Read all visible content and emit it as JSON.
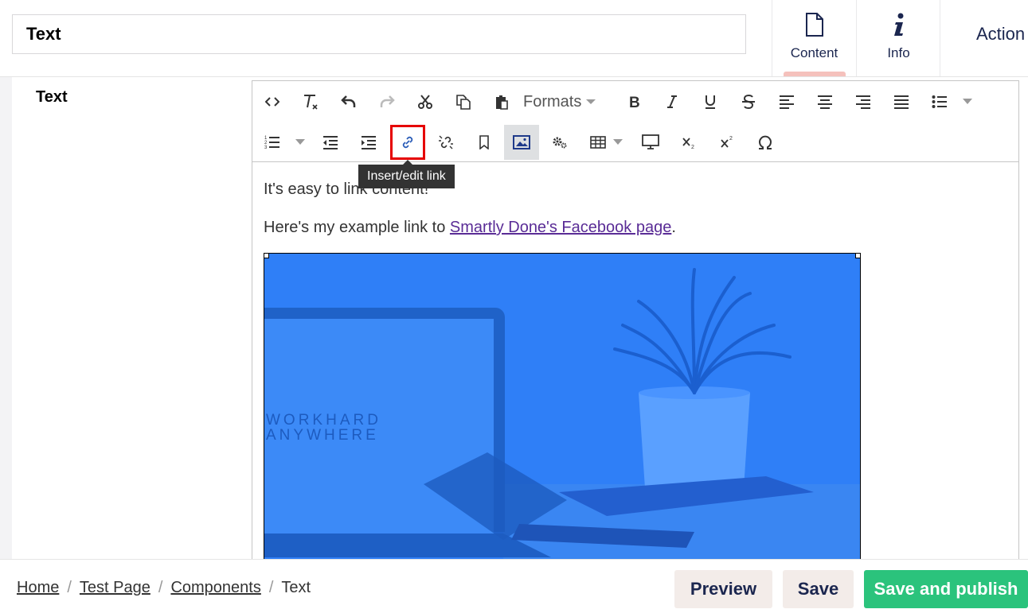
{
  "header": {
    "name_value": "Text",
    "tabs": [
      {
        "label": "Content",
        "icon": "document-icon"
      },
      {
        "label": "Info",
        "icon": "info-icon"
      }
    ],
    "actions_label": "Action"
  },
  "property": {
    "label": "Text"
  },
  "toolbar": {
    "formats_label": "Formats",
    "tooltip": "Insert/edit link"
  },
  "editor": {
    "para1": "It's easy to link content!",
    "para2_prefix": "Here's my example link to ",
    "link_text": "Smartly Done's Facebook page",
    "para2_suffix": ".",
    "image_text_line1": "WORKHARD",
    "image_text_line2": "ANYWHERE"
  },
  "footer": {
    "breadcrumb": [
      "Home",
      "Test Page",
      "Components",
      "Text"
    ],
    "preview_label": "Preview",
    "save_label": "Save",
    "publish_label": "Save and publish"
  },
  "colors": {
    "accent_green": "#2bc37c",
    "tab_active": "#f5c1bc",
    "link_purple": "#5a2c96",
    "image_blue": "#2f7ff7",
    "highlight_red": "#e60000"
  }
}
